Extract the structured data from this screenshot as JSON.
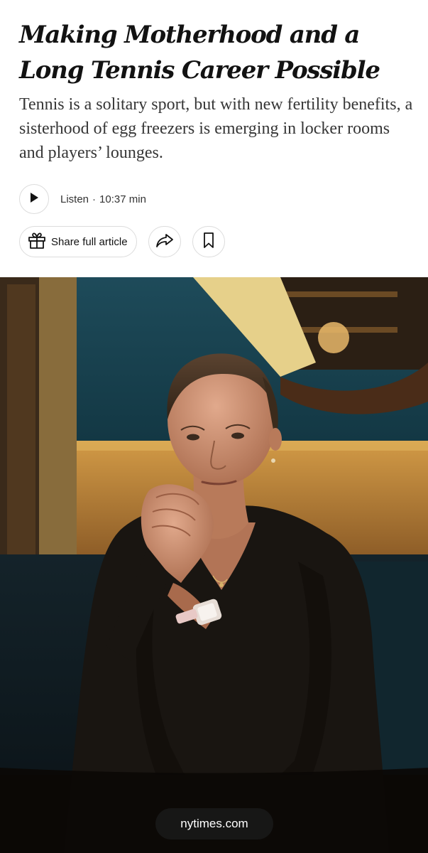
{
  "article": {
    "headline": "Making Motherhood and a Long Tennis Career Possible",
    "summary": "Tennis is a solitary sport, but with new fertility benefits, a sisterhood of egg freezers is emerging in locker rooms and players’ lounges."
  },
  "audio": {
    "listen_label": "Listen",
    "separator": "·",
    "duration": "10:37 min",
    "play_icon": "play-icon"
  },
  "actions": {
    "share_full_label": "Share full article",
    "gift_icon": "gift-icon",
    "share_icon": "share-arrow-icon",
    "bookmark_icon": "bookmark-icon"
  },
  "footer": {
    "domain": "nytimes.com"
  },
  "colors": {
    "text": "#121212",
    "summary_text": "#363636",
    "border": "#dcdcdc",
    "pill_background": "#191919"
  }
}
